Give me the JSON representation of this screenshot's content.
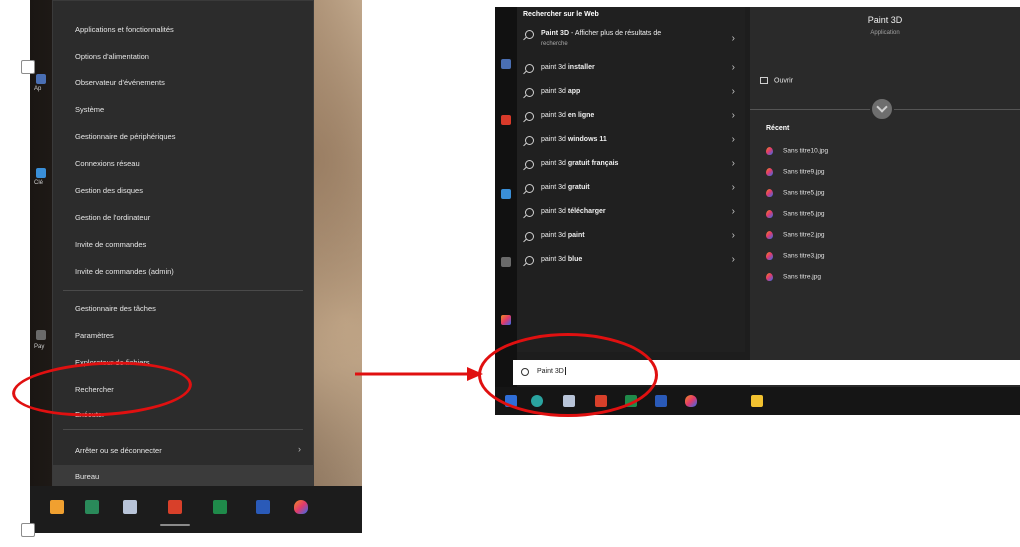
{
  "left_screenshot": {
    "desktop_labels": [
      "Ap",
      "Clé",
      "Pay"
    ],
    "menu_items": [
      {
        "label": "Applications et fonctionnalités"
      },
      {
        "label": "Options d'alimentation"
      },
      {
        "label": "Observateur d'événements"
      },
      {
        "label": "Système"
      },
      {
        "label": "Gestionnaire de périphériques"
      },
      {
        "label": "Connexions réseau"
      },
      {
        "label": "Gestion des disques"
      },
      {
        "label": "Gestion de l'ordinateur"
      },
      {
        "label": "Invite de commandes"
      },
      {
        "label": "Invite de commandes (admin)"
      },
      {
        "label": "Gestionnaire des tâches"
      },
      {
        "label": "Paramètres"
      },
      {
        "label": "Explorateur de fichiers"
      },
      {
        "label": "Rechercher"
      },
      {
        "label": "Exécuter"
      },
      {
        "label": "Arrêter ou se déconnecter",
        "submenu": true
      },
      {
        "label": "Bureau"
      }
    ],
    "submenu_chevron": "›"
  },
  "right_screenshot": {
    "heading": "Rechercher sur le Web",
    "web_result": {
      "bold": "Paint 3D",
      "rest": " - Afficher plus de résultats de",
      "sub": "recherche"
    },
    "suggestions": [
      {
        "prefix": "paint 3d ",
        "bold": "installer"
      },
      {
        "prefix": "paint 3d ",
        "bold": "app"
      },
      {
        "prefix": "paint 3d ",
        "bold": "en ligne"
      },
      {
        "prefix": "paint 3d ",
        "bold": "windows 11"
      },
      {
        "prefix": "paint 3d ",
        "bold": "gratuit français"
      },
      {
        "prefix": "paint 3d ",
        "bold": "gratuit"
      },
      {
        "prefix": "paint 3d ",
        "bold": "télécharger"
      },
      {
        "prefix": "paint 3d ",
        "bold": "paint"
      },
      {
        "prefix": "paint 3d ",
        "bold": "blue"
      }
    ],
    "chevron": "›",
    "detail": {
      "app_name": "Paint 3D",
      "app_type": "Application",
      "open_label": "Ouvrir",
      "recent_heading": "Récent",
      "recent_files": [
        "Sans titre10.jpg",
        "Sans titre9.jpg",
        "Sans titre5.jpg",
        "Sans titre5.jpg",
        "Sans titre2.jpg",
        "Sans titre3.jpg",
        "Sans titre.jpg"
      ]
    },
    "search_box_value": "Paint 3D"
  },
  "colors": {
    "annotation_red": "#e01010",
    "menu_bg": "#2c2c2c",
    "panel_bg": "#202020",
    "detail_bg": "#2a2a2a"
  }
}
